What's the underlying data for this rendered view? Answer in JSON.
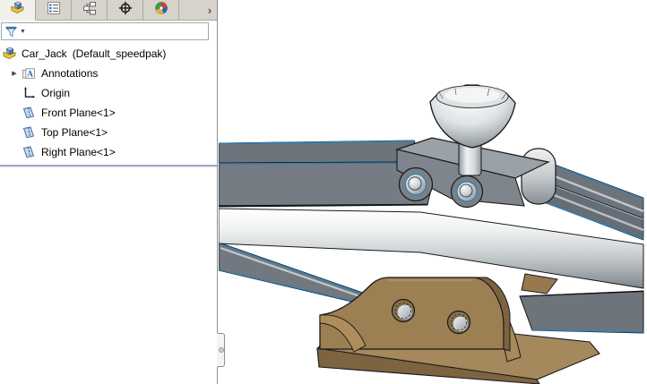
{
  "panel": {
    "tabs": [
      {
        "name": "featuremanager-design-tree",
        "selected": true
      },
      {
        "name": "propertymanager",
        "selected": false
      },
      {
        "name": "configurationmanager",
        "selected": false
      },
      {
        "name": "dimxpertmanager",
        "selected": false
      },
      {
        "name": "displaymanager",
        "selected": false
      }
    ],
    "tab_overflow": "›",
    "filter": {
      "value": "",
      "placeholder": ""
    },
    "tree": {
      "root": {
        "label": "Car_Jack",
        "config": "(Default_speedpak)"
      },
      "items": [
        {
          "label": "Annotations",
          "expandable": true
        },
        {
          "label": "Origin",
          "expandable": false
        },
        {
          "label": "Front Plane<1>",
          "expandable": false
        },
        {
          "label": "Top Plane<1>",
          "expandable": false
        },
        {
          "label": "Right Plane<1>",
          "expandable": false
        }
      ],
      "expander_glyph": "▶"
    }
  },
  "icons": {
    "tabs": [
      "assembly-tree-icon",
      "property-list-icon",
      "configurations-icon",
      "dimxpert-target-icon",
      "display-appearance-icon"
    ],
    "tree": [
      "assembly-icon",
      "annotations-icon",
      "origin-axes-icon",
      "plane-icon"
    ],
    "filter": [
      "funnel-filter-icon",
      "dropdown-caret-icon"
    ]
  },
  "colors": {
    "edge_highlight_blue": "#2e7fb5",
    "part_gray": "#71787e",
    "chrome_light": "#d8dbdd",
    "base_brass": "#9c7f53",
    "divider_lavender": "#a6a4c4",
    "tabbar_bg": "#d7d3cb",
    "viewport_bg": "#ffffff"
  },
  "viewport": {
    "model": "car jack scissor assembly"
  }
}
